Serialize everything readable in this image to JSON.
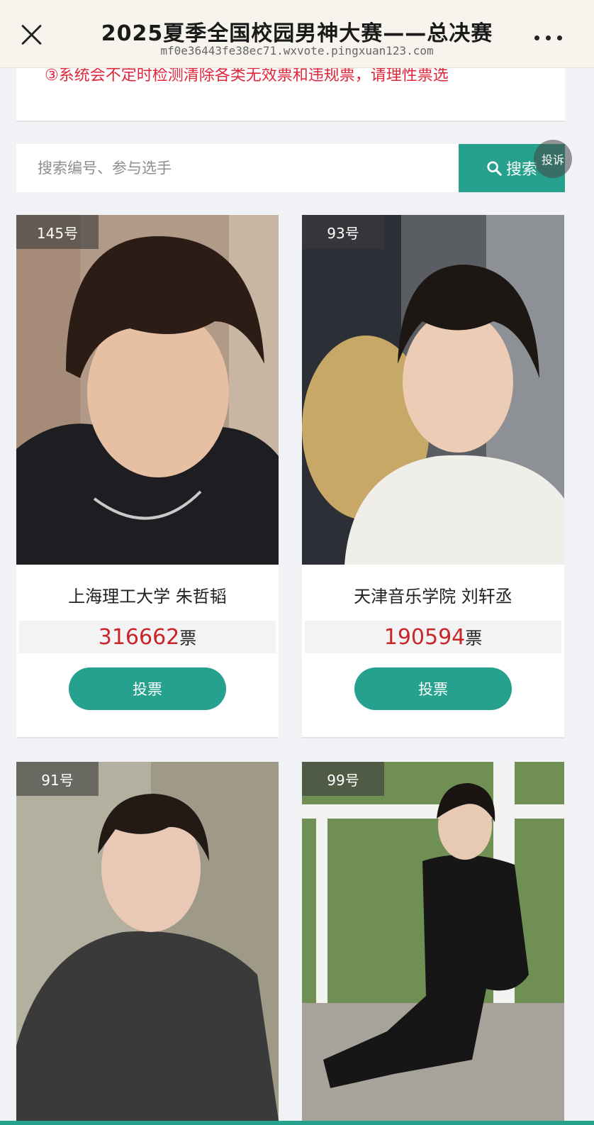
{
  "header": {
    "title": "2025夏季全国校园男神大赛——总决赛",
    "url": "mf0e36443fe38ec71.wxvote.pingxuan123.com",
    "close_icon": "close-icon",
    "more_icon": "more-dots-icon"
  },
  "notice": {
    "text": "③系统会不定时检测清除各类无效票和违规票，请理性票选"
  },
  "search": {
    "placeholder": "搜索编号、参与选手",
    "button_label": "搜索",
    "report_label": "投诉"
  },
  "contestants": [
    {
      "number": "145号",
      "name": "上海理工大学 朱哲韬",
      "votes": "316662",
      "unit": "票",
      "vote_label": "投票"
    },
    {
      "number": "93号",
      "name": "天津音乐学院 刘轩丞",
      "votes": "190594",
      "unit": "票",
      "vote_label": "投票"
    },
    {
      "number": "91号"
    },
    {
      "number": "99号"
    }
  ],
  "colors": {
    "accent": "#26a18e",
    "votes": "#c8262b",
    "notice": "#e0263a"
  }
}
